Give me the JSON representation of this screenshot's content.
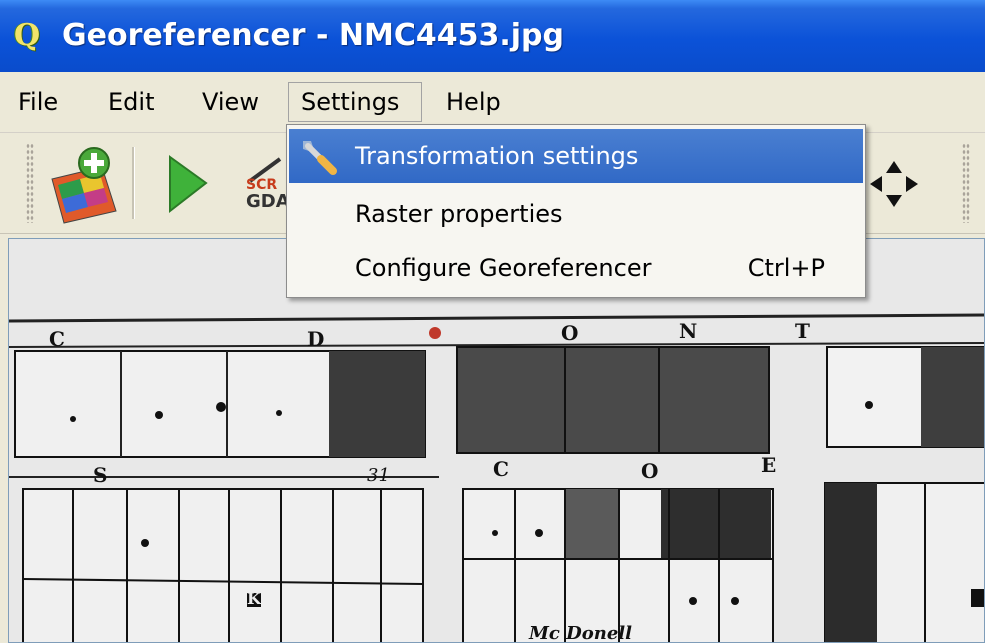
{
  "window": {
    "title": "Georeferencer - NMC4453.jpg",
    "app_icon": "qgis-logo-icon",
    "title_bar_color": "#0b52d8"
  },
  "menubar": {
    "items": [
      {
        "label": "File"
      },
      {
        "label": "Edit"
      },
      {
        "label": "View"
      },
      {
        "label": "Settings",
        "open": true
      },
      {
        "label": "Help"
      }
    ]
  },
  "toolbar": {
    "buttons": [
      {
        "icon": "add-raster-icon"
      },
      {
        "icon": "start-georeferencing-icon"
      },
      {
        "icon": "gdal-script-icon",
        "label": "GDA"
      },
      {
        "icon": "pan-arrows-icon"
      }
    ]
  },
  "settings_menu": {
    "items": [
      {
        "label": "Transformation settings",
        "icon": "wrench-icon",
        "shortcut": "",
        "selected": true
      },
      {
        "label": "Raster properties",
        "icon": "",
        "shortcut": "",
        "selected": false
      },
      {
        "label": "Configure Georeferencer",
        "icon": "",
        "shortcut": "Ctrl+P",
        "selected": false
      }
    ],
    "highlight_color": "#3169c6"
  },
  "map": {
    "labels": [
      "C",
      "D",
      "O",
      "N",
      "T",
      "S",
      "C",
      "O",
      "E",
      "K"
    ],
    "handwriting": [
      "31",
      "Mc Donell"
    ]
  }
}
